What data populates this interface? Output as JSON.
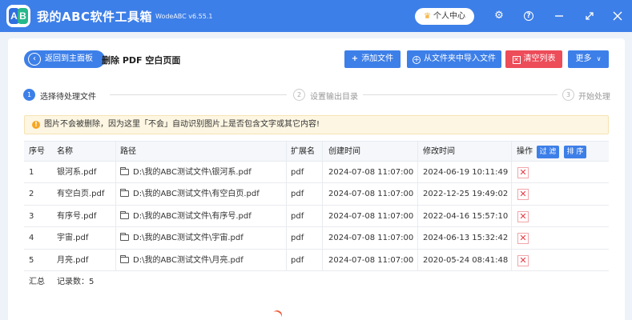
{
  "app": {
    "logo_left": "A",
    "logo_right": "B",
    "title": "我的ABC软件工具箱",
    "version": "WodeABC v6.55.1",
    "vip_label": "个人中心"
  },
  "toolbar": {
    "back_label": "返回到主面板",
    "page_title": "删除 PDF 空白页面",
    "add_file": "添加文件",
    "import_folder": "从文件夹中导入文件",
    "clear_list": "清空列表",
    "more": "更多"
  },
  "steps": [
    {
      "num": "1",
      "label": "选择待处理文件"
    },
    {
      "num": "2",
      "label": "设置输出目录"
    },
    {
      "num": "3",
      "label": "开始处理"
    }
  ],
  "warning": "图片不会被删除，因为这里「不会」自动识别图片上是否包含文字或其它内容!",
  "table": {
    "headers": {
      "index": "序号",
      "name": "名称",
      "path": "路径",
      "ext": "扩展名",
      "created": "创建时间",
      "modified": "修改时间",
      "action": "操作",
      "filter": "过 滤",
      "sort": "排 序"
    },
    "rows": [
      {
        "index": "1",
        "name": "银河系.pdf",
        "path": "D:\\我的ABC测试文件\\银河系.pdf",
        "ext": "pdf",
        "created": "2024-07-08 11:07:00",
        "modified": "2024-06-19 10:11:49"
      },
      {
        "index": "2",
        "name": "有空白页.pdf",
        "path": "D:\\我的ABC测试文件\\有空白页.pdf",
        "ext": "pdf",
        "created": "2024-07-08 11:07:00",
        "modified": "2022-12-25 19:49:02"
      },
      {
        "index": "3",
        "name": "有序号.pdf",
        "path": "D:\\我的ABC测试文件\\有序号.pdf",
        "ext": "pdf",
        "created": "2024-07-08 11:07:00",
        "modified": "2022-04-16 15:57:10"
      },
      {
        "index": "4",
        "name": "宇宙.pdf",
        "path": "D:\\我的ABC测试文件\\宇宙.pdf",
        "ext": "pdf",
        "created": "2024-07-08 11:07:00",
        "modified": "2024-06-13 15:32:42"
      },
      {
        "index": "5",
        "name": "月亮.pdf",
        "path": "D:\\我的ABC测试文件\\月亮.pdf",
        "ext": "pdf",
        "created": "2024-07-08 11:07:00",
        "modified": "2020-05-24 08:41:48"
      }
    ],
    "summary_label": "汇总",
    "record_count": "记录数：5"
  },
  "icons": {
    "vip": "crown-icon",
    "settings": "gear-icon",
    "help": "help-icon",
    "minimize": "minimize-icon",
    "maximize": "maximize-icon",
    "close": "close-icon",
    "delete": "delete-icon",
    "folder": "folder-icon"
  },
  "colors": {
    "primary": "#3d7fe8",
    "danger": "#ed4c59",
    "warning_bg": "#fdf6e2",
    "warning_icon": "#f5a623"
  }
}
